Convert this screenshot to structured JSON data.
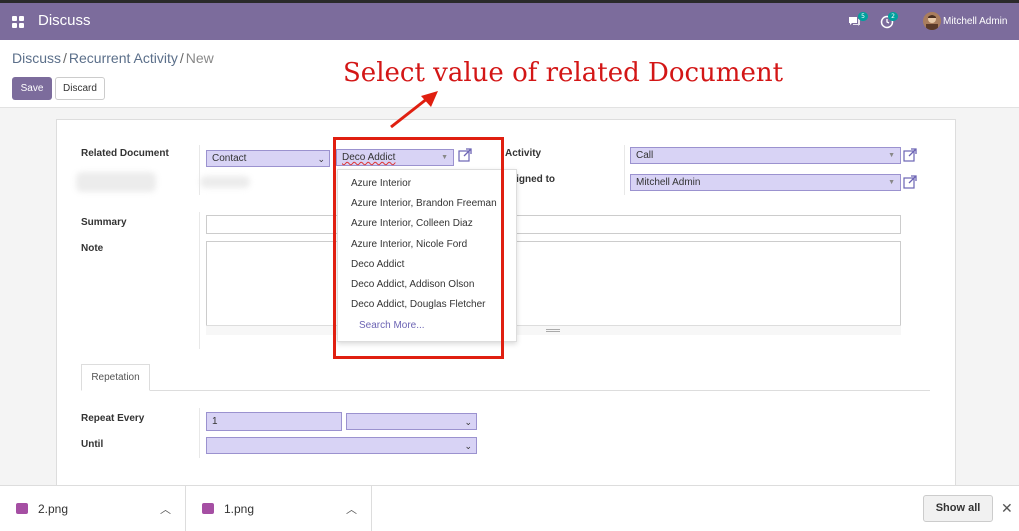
{
  "topbar": {
    "app_title": "Discuss",
    "chat_badge": "5",
    "activity_badge": "2",
    "user_name": "Mitchell Admin"
  },
  "breadcrumb": {
    "items": [
      "Discuss",
      "Recurrent Activity"
    ],
    "current": "New"
  },
  "buttons": {
    "save": "Save",
    "discard": "Discard"
  },
  "annotation": "Select value of related Document",
  "form": {
    "related_document_label": "Related Document",
    "model_value": "Contact",
    "record_value": "Deco Addict",
    "activity_label": "Activity",
    "activity_value": "Call",
    "assigned_label": "ssigned to",
    "assigned_value": "Mitchell Admin",
    "summary_label": "Summary",
    "note_label": "Note"
  },
  "dropdown": {
    "items": [
      "Azure Interior",
      "Azure Interior, Brandon Freeman",
      "Azure Interior, Colleen Diaz",
      "Azure Interior, Nicole Ford",
      "Deco Addict",
      "Deco Addict, Addison Olson",
      "Deco Addict, Douglas Fletcher"
    ],
    "search_more": "Search More..."
  },
  "tabs": [
    "Repetation"
  ],
  "repetition": {
    "repeat_every_label": "Repeat Every",
    "repeat_every_value": "1",
    "until_label": "Until"
  },
  "downloads": {
    "files": [
      "2.png",
      "1.png"
    ],
    "show_all": "Show all"
  },
  "colors": {
    "topbar": "#7c6c9c",
    "highlight": "#e01f10",
    "annotation": "#d31616",
    "field_fill": "#d8d3f5"
  }
}
